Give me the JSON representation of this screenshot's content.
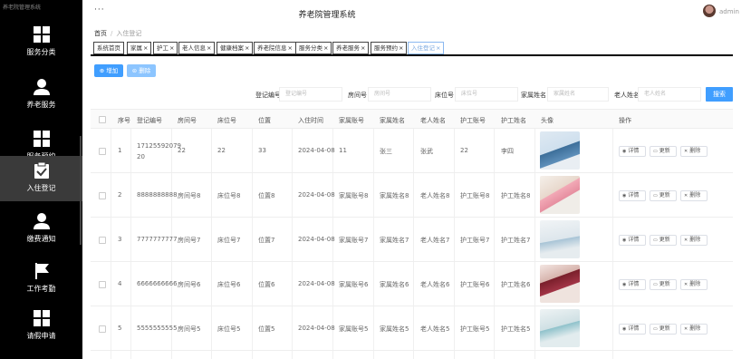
{
  "sidebar": {
    "top_text": "养老院管理系统",
    "items": [
      {
        "label": "服务分类",
        "icon": "grid-icon"
      },
      {
        "label": "养老服务",
        "icon": "person-icon"
      },
      {
        "label": "服务预约",
        "icon": "grid-icon"
      },
      {
        "label": "入住登记",
        "icon": "clipboard-check-icon",
        "active": true
      },
      {
        "label": "缴费通知",
        "icon": "person-icon"
      },
      {
        "label": "工作考勤",
        "icon": "flag-icon"
      },
      {
        "label": "请假申请",
        "icon": "grid-icon"
      }
    ]
  },
  "header": {
    "menu_dots": "···",
    "title": "养老院管理系统",
    "user": "admin"
  },
  "breadcrumb": {
    "home": "首页",
    "current": "入住登记"
  },
  "tabs": [
    {
      "label": "系统首页",
      "closable": false
    },
    {
      "label": "家属",
      "closable": true
    },
    {
      "label": "护工",
      "closable": true
    },
    {
      "label": "老人信息",
      "closable": true
    },
    {
      "label": "健康档案",
      "closable": true
    },
    {
      "label": "养老院信息",
      "closable": true
    },
    {
      "label": "服务分类",
      "closable": true
    },
    {
      "label": "养老服务",
      "closable": true
    },
    {
      "label": "服务预约",
      "closable": true
    },
    {
      "label": "入住登记",
      "closable": true,
      "active": true
    }
  ],
  "tab_close": "×",
  "actions": {
    "add": "⊕ 增加",
    "delete": "⊜ 删除"
  },
  "search": {
    "fields": [
      {
        "label": "登记编号",
        "placeholder": "登记编号"
      },
      {
        "label": "房间号",
        "placeholder": "房间号"
      },
      {
        "label": "床位号",
        "placeholder": "床位号"
      },
      {
        "label": "家属姓名",
        "placeholder": "家属姓名"
      },
      {
        "label": "老人姓名",
        "placeholder": "老人姓名"
      }
    ],
    "button": "搜索"
  },
  "table": {
    "headers": [
      "序号",
      "登记编号",
      "房间号",
      "床位号",
      "位置",
      "入住时间",
      "家属账号",
      "家属姓名",
      "老人姓名",
      "护工账号",
      "护工姓名",
      "头像",
      "操作"
    ],
    "rows": [
      {
        "index": "1",
        "reg_no": "17125592079",
        "reg_no_2": "20",
        "room": "22",
        "bed": "22",
        "loc": "33",
        "date": "2024-04-08",
        "fam_acc": "11",
        "fam_name": "张三",
        "elder": "张武",
        "care_acc": "22",
        "care_name": "李四"
      },
      {
        "index": "2",
        "reg_no": "8888888888",
        "reg_no_2": "",
        "room": "房间号8",
        "bed": "床位号8",
        "loc": "位置8",
        "date": "2024-04-08",
        "fam_acc": "家属账号8",
        "fam_name": "家属姓名8",
        "elder": "老人姓名8",
        "care_acc": "护工账号8",
        "care_name": "护工姓名8"
      },
      {
        "index": "3",
        "reg_no": "7777777777",
        "reg_no_2": "",
        "room": "房间号7",
        "bed": "床位号7",
        "loc": "位置7",
        "date": "2024-04-08",
        "fam_acc": "家属账号7",
        "fam_name": "家属姓名7",
        "elder": "老人姓名7",
        "care_acc": "护工账号7",
        "care_name": "护工姓名7"
      },
      {
        "index": "4",
        "reg_no": "6666666666",
        "reg_no_2": "",
        "room": "房间号6",
        "bed": "床位号6",
        "loc": "位置6",
        "date": "2024-04-08",
        "fam_acc": "家属账号6",
        "fam_name": "家属姓名6",
        "elder": "老人姓名6",
        "care_acc": "护工账号6",
        "care_name": "护工姓名6"
      },
      {
        "index": "5",
        "reg_no": "5555555555",
        "reg_no_2": "",
        "room": "房间号5",
        "bed": "床位号5",
        "loc": "位置5",
        "date": "2024-04-08",
        "fam_acc": "家属账号5",
        "fam_name": "家属姓名5",
        "elder": "老人姓名5",
        "care_acc": "护工账号5",
        "care_name": "护工姓名5"
      }
    ],
    "ops": {
      "detail": "详情",
      "update": "更新",
      "delete": "删除"
    }
  },
  "colors": {
    "primary": "#409eff",
    "primary_light": "#8cc5ff",
    "sidebar_bg": "#000000",
    "active_tab": "#7aa8e0"
  }
}
